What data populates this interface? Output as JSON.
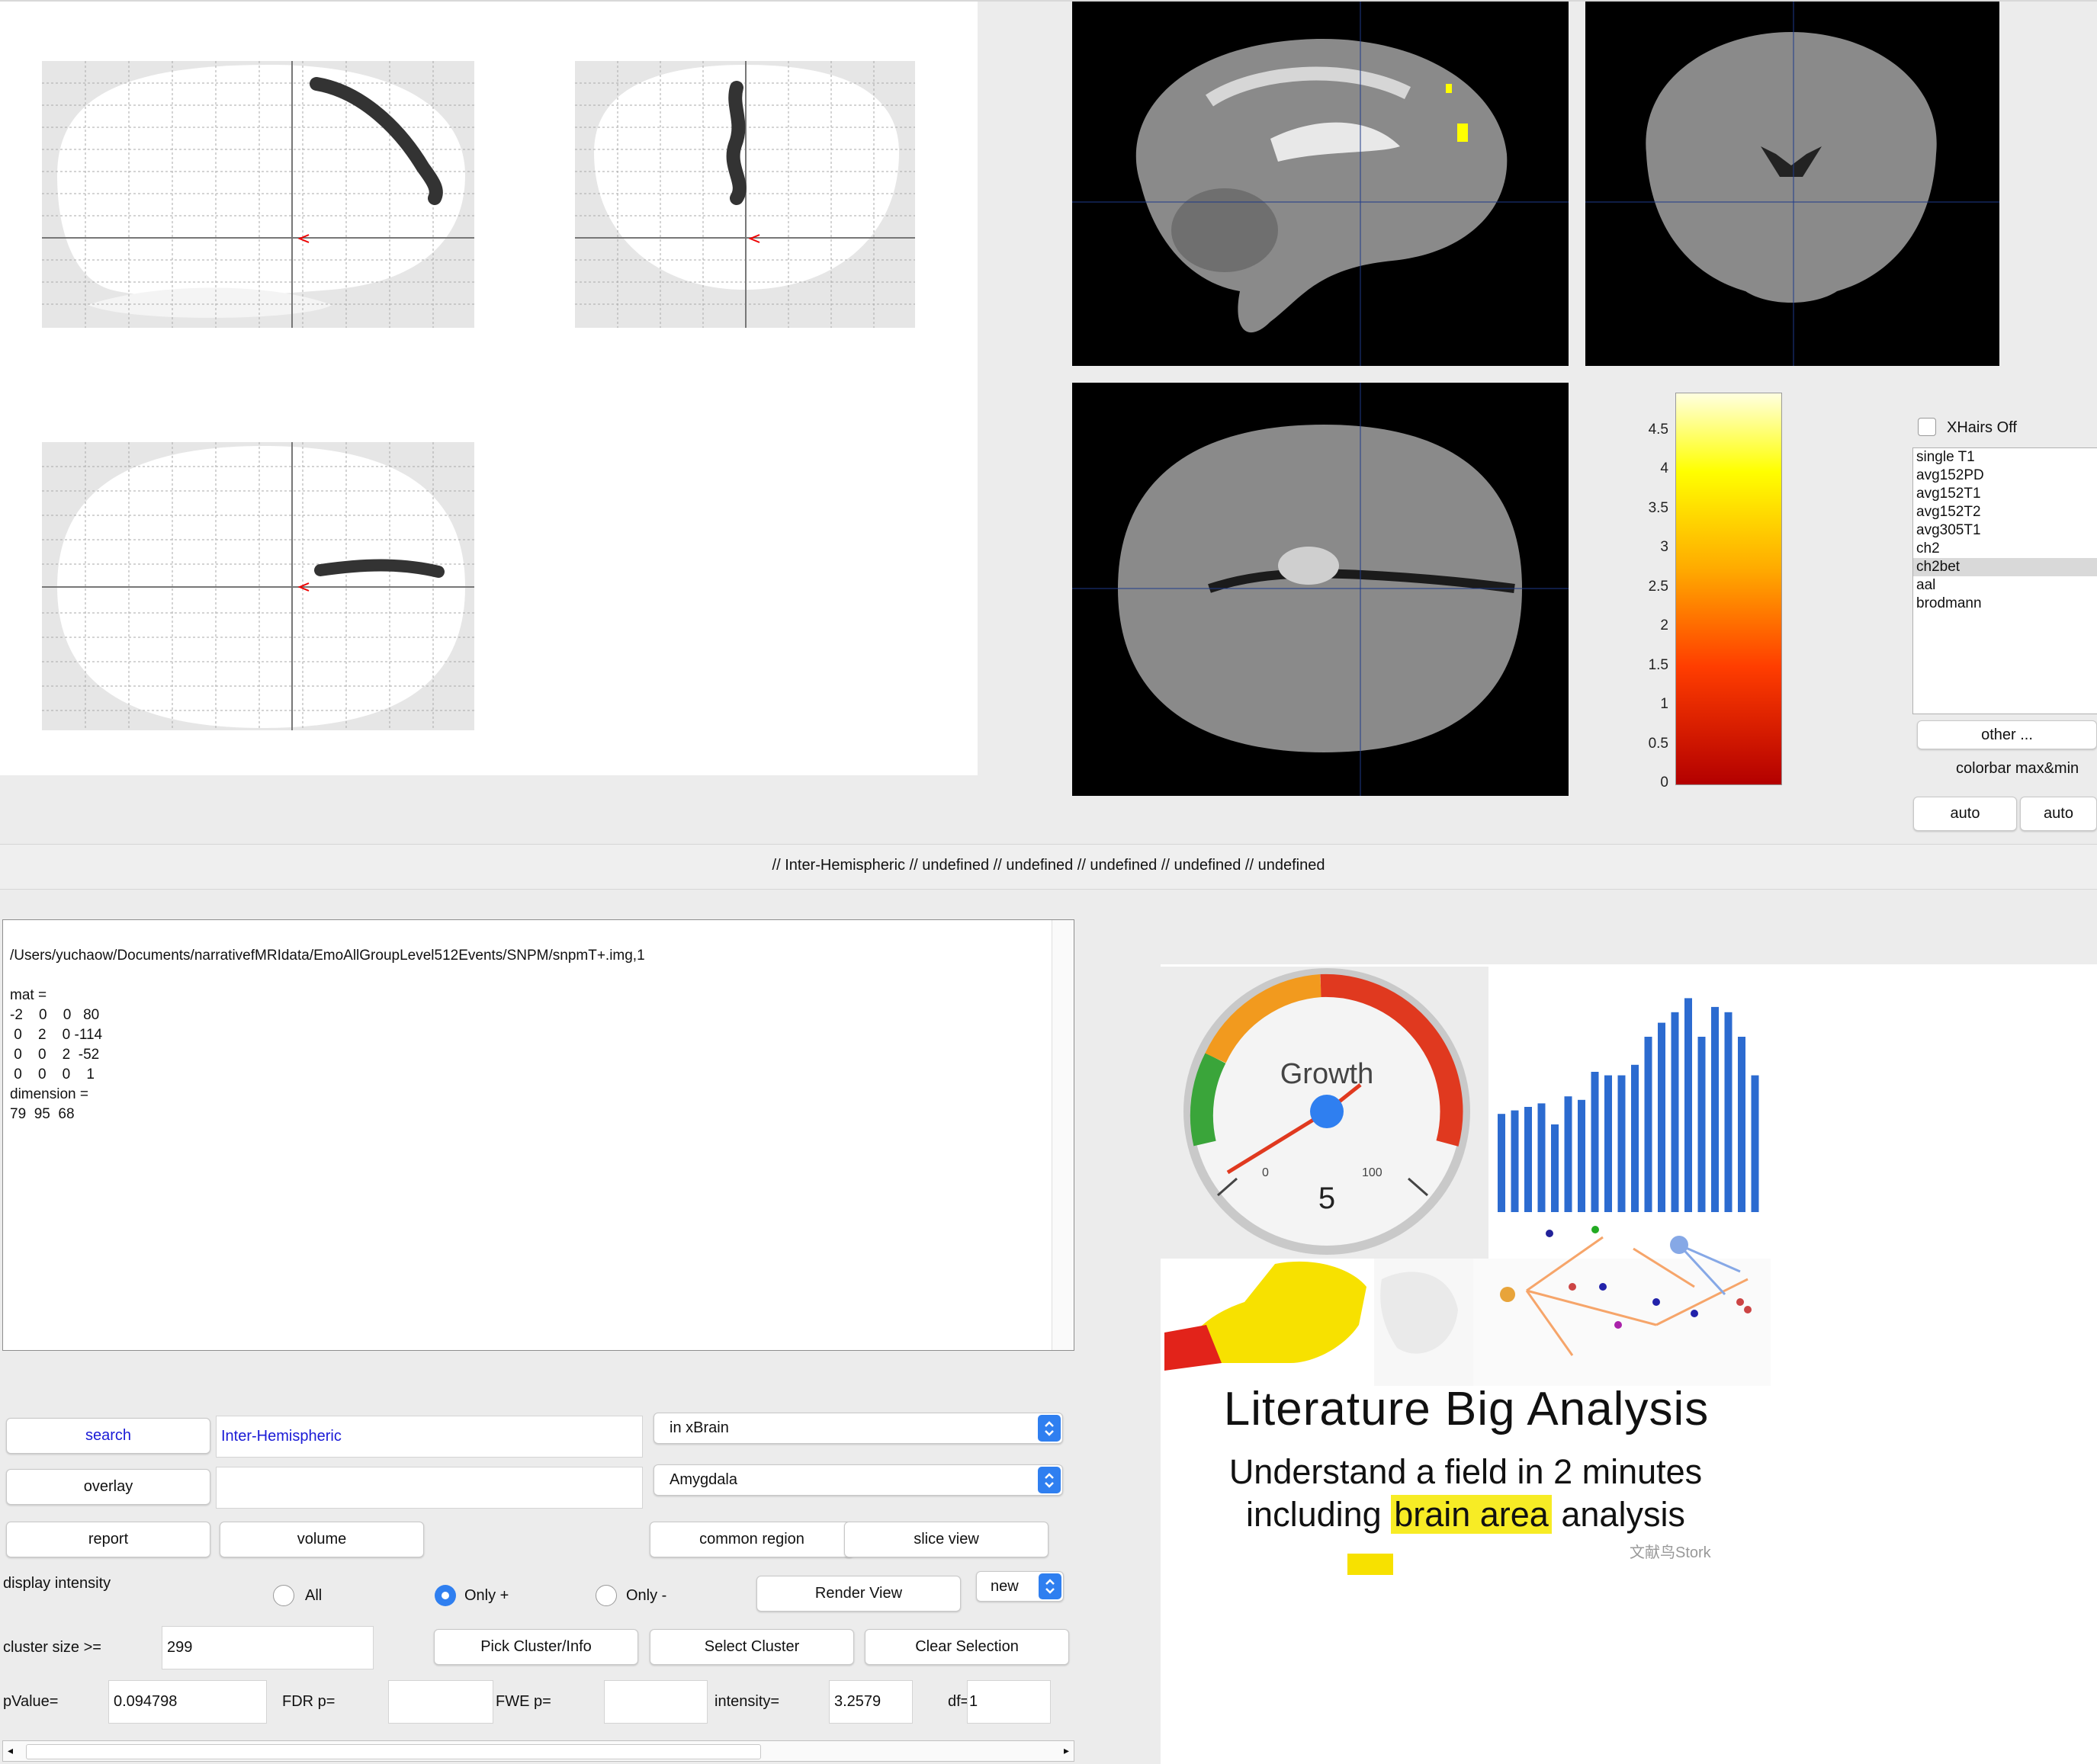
{
  "status_line": "// Inter-Hemispheric // undefined // undefined // undefined // undefined // undefined",
  "xhairs": {
    "label": "XHairs Off",
    "checked": false
  },
  "template_list": {
    "items": [
      "single T1",
      "avg152PD",
      "avg152T1",
      "avg152T2",
      "avg305T1",
      "ch2",
      "ch2bet",
      "aal",
      "brodmann"
    ],
    "selected": "ch2bet"
  },
  "other_button": "other ...",
  "colorbar": {
    "title": "colorbar max&min",
    "ticks": [
      "4.5",
      "4",
      "3.5",
      "3",
      "2.5",
      "2",
      "1.5",
      "1",
      "0.5",
      "0"
    ],
    "auto_left": "auto",
    "auto_right": "auto"
  },
  "info_text": "/Users/yuchaow/Documents/narrativefMRIdata/EmoAllGroupLevel512Events/SNPM/snpmT+.img,1\n\nmat =\n-2    0    0   80\n 0    2    0 -114\n 0    0    2  -52\n 0    0    0    1\ndimension =\n79  95  68",
  "controls": {
    "search_btn": "search",
    "search_value": "Inter-Hemispheric",
    "scope_select": "in xBrain",
    "overlay_btn": "overlay",
    "overlay_value": "",
    "region_select": "Amygdala",
    "report_btn": "report",
    "volume_btn": "volume",
    "common_region_btn": "common region",
    "slice_view_btn": "slice view",
    "display_intensity": "display intensity",
    "radio_all": "All",
    "radio_only_pos": "Only +",
    "radio_only_neg": "Only -",
    "radio_selected": "Only +",
    "render_view_btn": "Render View",
    "new_select": "new",
    "cluster_size_label": "cluster size >=",
    "cluster_size": "299",
    "pick_cluster_btn": "Pick Cluster/Info",
    "select_cluster_btn": "Select Cluster",
    "clear_selection_btn": "Clear Selection",
    "pvalue_label": "pValue=",
    "pvalue": "0.094798",
    "fdr_label": "FDR p=",
    "fdr": "",
    "fwe_label": "FWE p=",
    "fwe": "",
    "intensity_label": "intensity=",
    "intensity": "3.2579",
    "df_label": "df=",
    "df": "1"
  },
  "ad": {
    "gauge_title": "Growth",
    "gauge_value": "5",
    "gauge_min": "0",
    "gauge_max": "100",
    "headline": "Literature Big Analysis",
    "line1": "Understand a field in 2 minutes",
    "line2_pre": "including",
    "line2_highlight": "brain area",
    "line2_post": "analysis",
    "watermark": "文献鸟Stork",
    "bar_values": [
      0.56,
      0.58,
      0.6,
      0.62,
      0.5,
      0.66,
      0.64,
      0.8,
      0.78,
      0.78,
      0.84,
      1.0,
      1.08,
      1.14,
      1.22,
      1.0,
      1.17,
      1.14,
      1.0,
      0.78
    ],
    "colors": {
      "gauge_green": "#3aa53a",
      "gauge_orange": "#f29a1e",
      "gauge_red": "#e0391f",
      "bar_blue": "#2c6bd0",
      "highlight": "#f7ec25"
    }
  }
}
